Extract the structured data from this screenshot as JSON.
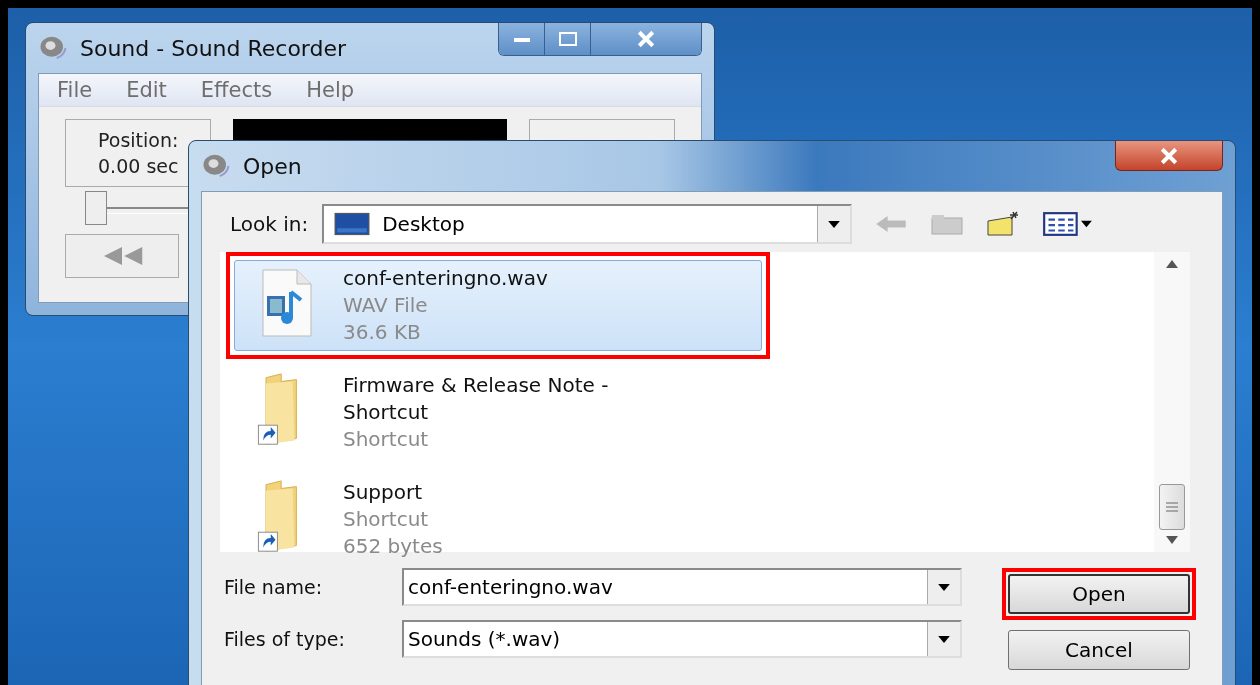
{
  "recorder": {
    "title": "Sound - Sound Recorder",
    "menu": [
      "File",
      "Edit",
      "Effects",
      "Help"
    ],
    "position_label": "Position:",
    "position_value": "0.00 sec",
    "slider": {
      "level": 0
    }
  },
  "dialog": {
    "title": "Open",
    "look_in_label": "Look in:",
    "look_in_value": "Desktop",
    "files": [
      {
        "kind": "audio",
        "name": "conf-enteringno.wav",
        "details": [
          "WAV File",
          "36.6 KB"
        ],
        "selected": true,
        "highlighted": true
      },
      {
        "kind": "shortcut",
        "name": "Firmware & Release Note - Shortcut",
        "details": [
          "Shortcut"
        ],
        "selected": false,
        "highlighted": false
      },
      {
        "kind": "shortcut",
        "name": "Support",
        "details": [
          "Shortcut",
          "652 bytes"
        ],
        "selected": false,
        "highlighted": false
      }
    ],
    "file_name_label": "File name:",
    "file_name_value": "conf-enteringno.wav",
    "file_type_label": "Files of type:",
    "file_type_value": "Sounds (*.wav)",
    "buttons": [
      {
        "label": "Open",
        "highlighted": true
      },
      {
        "label": "Cancel",
        "highlighted": false
      }
    ]
  }
}
